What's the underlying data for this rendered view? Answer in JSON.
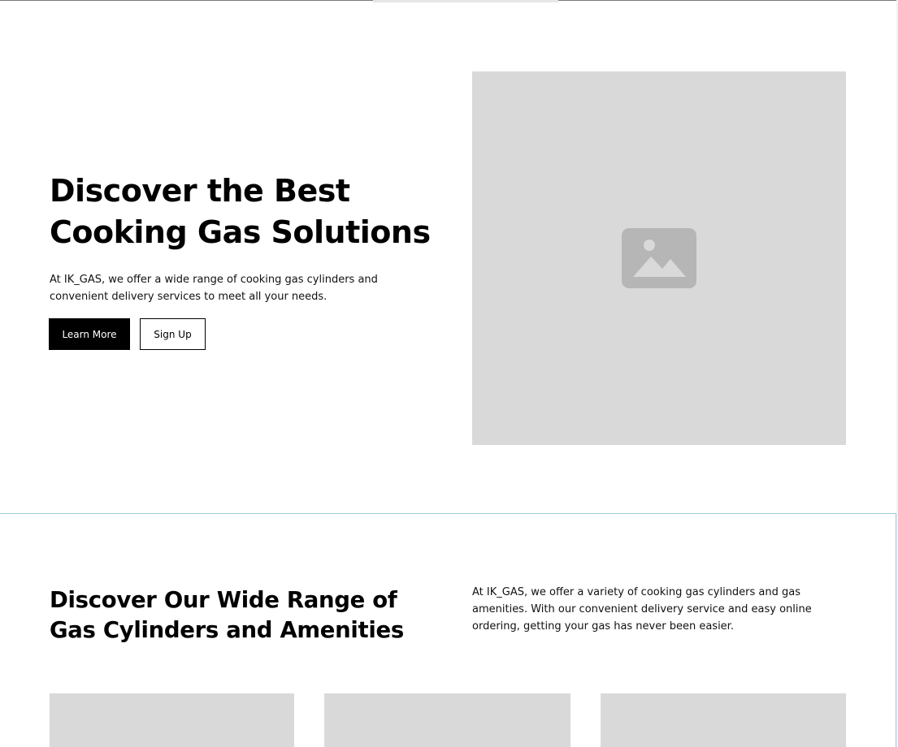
{
  "hero": {
    "title": "Discover the Best Cooking Gas Solutions",
    "description": "At IK_GAS, we offer a wide range of cooking gas cylinders and convenient delivery services to meet all your needs.",
    "primary_button": "Learn More",
    "secondary_button": "Sign Up",
    "image_icon": "image-placeholder-icon"
  },
  "features": {
    "title": "Discover Our Wide Range of Gas Cylinders and Amenities",
    "description": "At IK_GAS, we offer a variety of cooking gas cylinders and gas amenities. With our convenient delivery service and easy online ordering, getting your gas has never been easier."
  },
  "colors": {
    "placeholder_bg": "#d9d9d9",
    "placeholder_icon": "#b6b6b6",
    "divider": "#9ccbe3",
    "primary": "#000000"
  }
}
